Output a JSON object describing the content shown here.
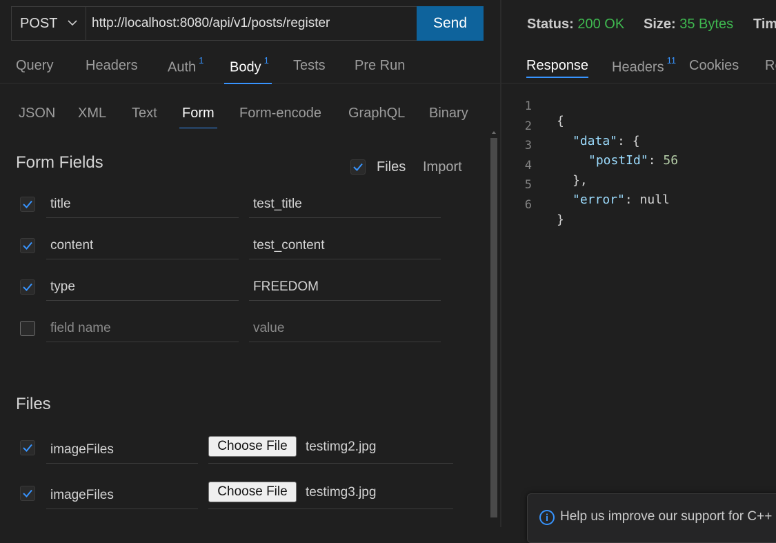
{
  "request": {
    "method": "POST",
    "url": "http://localhost:8080/api/v1/posts/register",
    "send_label": "Send",
    "tabs": [
      {
        "label": "Query",
        "badge": ""
      },
      {
        "label": "Headers",
        "badge": ""
      },
      {
        "label": "Auth",
        "badge": "1"
      },
      {
        "label": "Body",
        "badge": "1"
      },
      {
        "label": "Tests",
        "badge": ""
      },
      {
        "label": "Pre Run",
        "badge": ""
      }
    ],
    "active_tab": "Body"
  },
  "body": {
    "tabs": [
      "JSON",
      "XML",
      "Text",
      "Form",
      "Form-encode",
      "GraphQL",
      "Binary"
    ],
    "active_tab": "Form",
    "form_fields_title": "Form Fields",
    "files_toggle_label": "Files",
    "files_toggle_checked": true,
    "import_label": "Import",
    "fields": [
      {
        "checked": true,
        "name": "title",
        "value": "test_title"
      },
      {
        "checked": true,
        "name": "content",
        "value": "test_content"
      },
      {
        "checked": true,
        "name": "type",
        "value": "FREEDOM"
      },
      {
        "checked": false,
        "name": "",
        "value": "",
        "name_placeholder": "field name",
        "value_placeholder": "value"
      }
    ],
    "files_title": "Files",
    "files": [
      {
        "checked": true,
        "name": "imageFiles",
        "button": "Choose File",
        "file": "testimg2.jpg"
      },
      {
        "checked": true,
        "name": "imageFiles",
        "button": "Choose File",
        "file": "testimg3.jpg"
      }
    ]
  },
  "response": {
    "status_label": "Status:",
    "status_value": "200 OK",
    "size_label": "Size:",
    "size_value": "35 Bytes",
    "time_label": "Time:",
    "tabs": [
      {
        "label": "Response",
        "badge": ""
      },
      {
        "label": "Headers",
        "badge": "11"
      },
      {
        "label": "Cookies",
        "badge": ""
      },
      {
        "label": "Results",
        "badge": ""
      }
    ],
    "active_tab": "Response",
    "code_lines": [
      "1",
      "2",
      "3",
      "4",
      "5",
      "6"
    ],
    "json": {
      "open_brace": "{",
      "data_key": "\"data\"",
      "data_open": ": {",
      "postid_key": "\"postId\"",
      "postid_val": "56",
      "data_close": "},",
      "error_key": "\"error\"",
      "error_val": ": null",
      "close_brace": "}"
    }
  },
  "toast": {
    "message": "Help us improve our support for C++"
  },
  "colors": {
    "accent": "#3794ff",
    "send_button": "#0e639c",
    "status_ok": "#3fb950"
  }
}
